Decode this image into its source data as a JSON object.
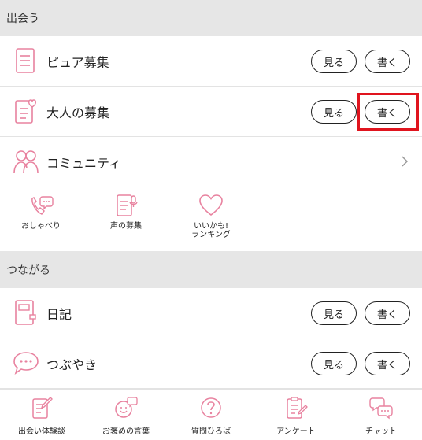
{
  "sections": {
    "deai": {
      "title": "出会う"
    },
    "tsunagaru": {
      "title": "つながる"
    }
  },
  "rows": {
    "pure_boshu": {
      "label": "ピュア募集",
      "view": "見る",
      "write": "書く"
    },
    "otona_boshu": {
      "label": "大人の募集",
      "view": "見る",
      "write": "書く"
    },
    "community": {
      "label": "コミュニティ"
    },
    "diary": {
      "label": "日記",
      "view": "見る",
      "write": "書く"
    },
    "tsubuyaki": {
      "label": "つぶやき",
      "view": "見る",
      "write": "書く"
    }
  },
  "quick_links": {
    "oshaberi": "おしゃべり",
    "koe_boshu": "声の募集",
    "iikamo": "いいかも!\nランキング"
  },
  "bottom_nav": {
    "experience": "出会い体験談",
    "praise": "お褒めの言葉",
    "questions": "質問ひろば",
    "survey": "アンケート",
    "chat": "チャット"
  },
  "colors": {
    "accent": "#e8829f",
    "highlight": "#e0141e",
    "section_bg": "#e6e6e6"
  }
}
